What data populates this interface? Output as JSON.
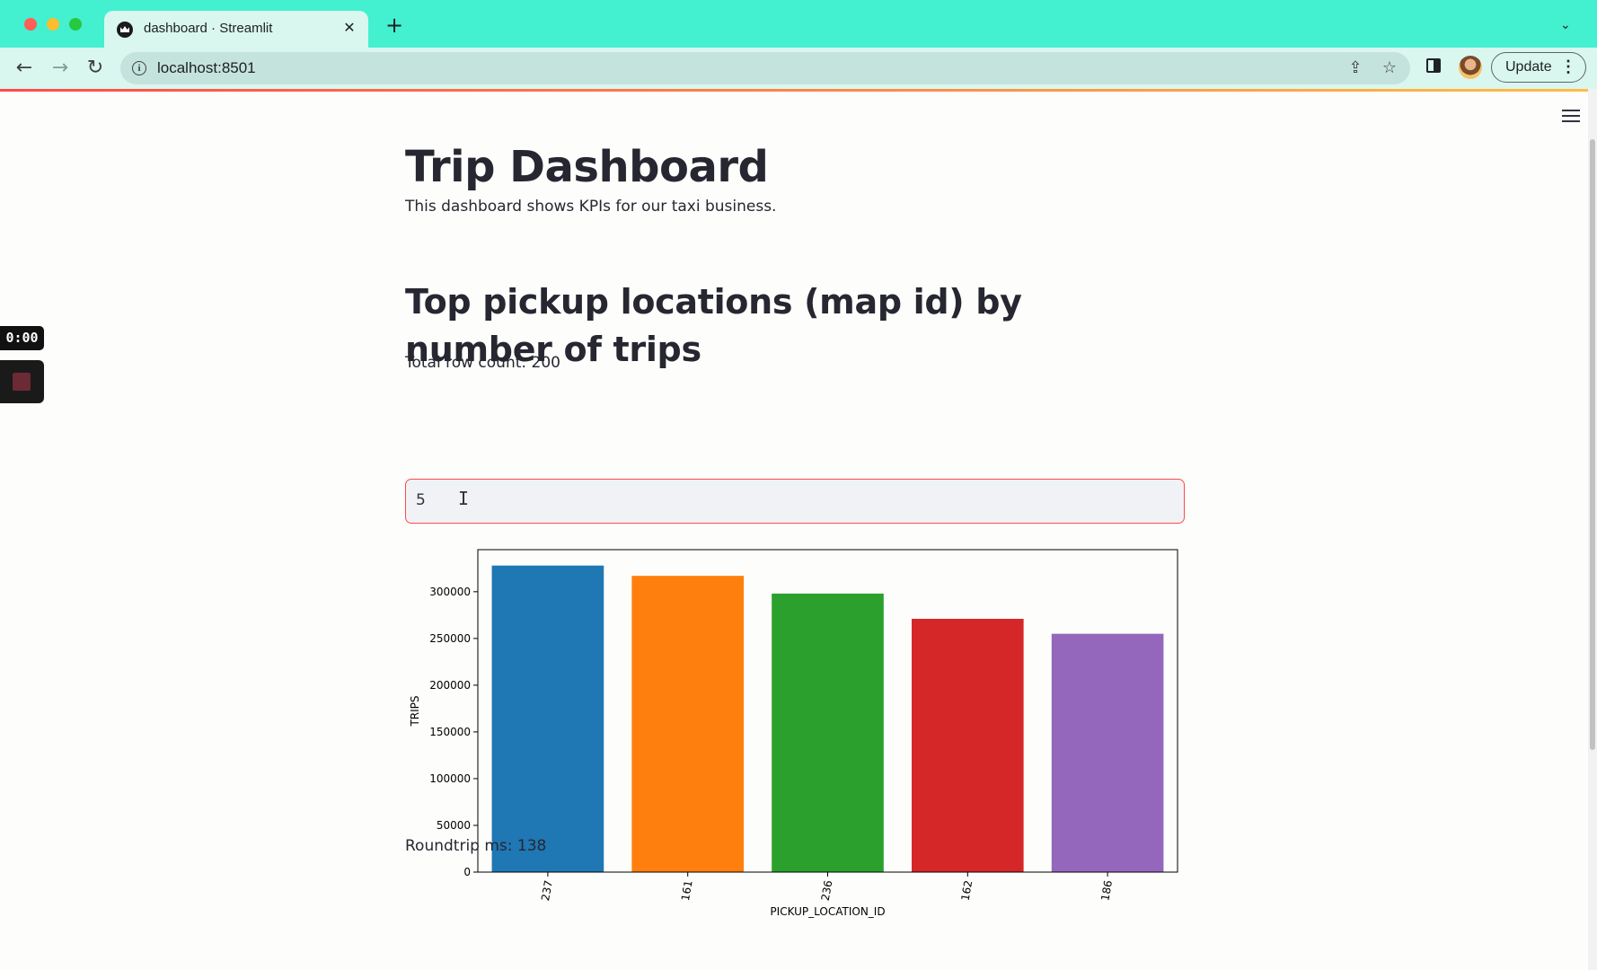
{
  "browser": {
    "tab_title": "dashboard · Streamlit",
    "tab_close": "✕",
    "new_tab": "+",
    "tab_menu": "⌄",
    "url": "localhost:8501",
    "update_label": "Update",
    "update_menu": "⋮",
    "icons": [
      "back-icon",
      "forward-icon",
      "reload-icon",
      "info-icon",
      "share-icon",
      "bookmark-star-icon",
      "side-panel-icon"
    ]
  },
  "recorder": {
    "time": "0:00"
  },
  "page": {
    "title": "Trip Dashboard",
    "intro": "This dashboard shows KPIs for our taxi business.",
    "section_heading": "Top pickup locations (map id) by number of trips",
    "row_count": "Total row count: 200",
    "top_n_value": "5",
    "roundtrip": "Roundtrip ms: 138"
  },
  "chart_data": {
    "type": "bar",
    "categories": [
      "237",
      "161",
      "236",
      "162",
      "186"
    ],
    "values": [
      328000,
      317000,
      298000,
      271000,
      255000
    ],
    "colors": [
      "#1f77b4",
      "#ff7f0e",
      "#2ca02c",
      "#d62728",
      "#9467bd"
    ],
    "xlabel": "PICKUP_LOCATION_ID",
    "ylabel": "TRIPS",
    "ylim": [
      0,
      345000
    ],
    "yticks": [
      "0",
      "50000",
      "100000",
      "150000",
      "200000",
      "250000",
      "300000"
    ],
    "grid": false
  }
}
